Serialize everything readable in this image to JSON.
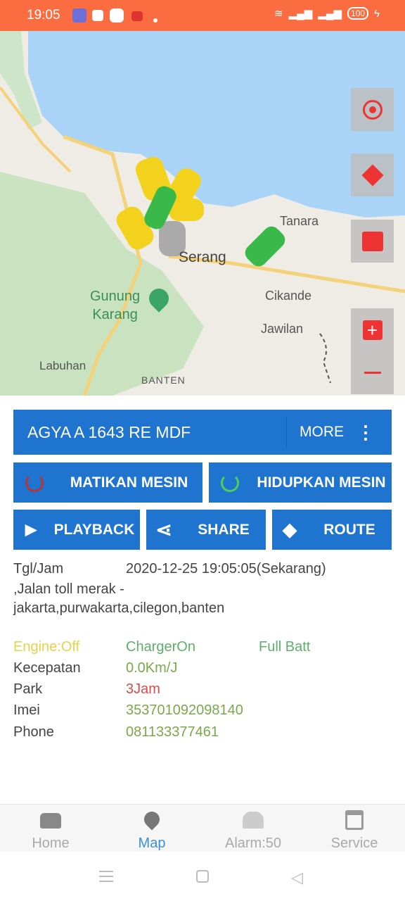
{
  "status_bar": {
    "time": "19:05",
    "battery": "100"
  },
  "map": {
    "labels": {
      "tanara": "Tanara",
      "serang": "Serang",
      "gunung_karang": "Gunung\nKarang",
      "cikande": "Cikande",
      "jawilan": "Jawilan",
      "labuhan": "Labuhan",
      "banten": "BANTEN"
    }
  },
  "vehicle": {
    "title": "AGYA A 1643 RE MDF",
    "more": "MORE"
  },
  "actions": {
    "engine_off": "MATIKAN MESIN",
    "engine_on": "HIDUPKAN MESIN",
    "playback": "PLAYBACK",
    "share": "SHARE",
    "route": "ROUTE"
  },
  "details": {
    "datetime_label": "Tgl/Jam",
    "datetime_value": "2020-12-25 19:05:05(Sekarang)",
    "address_line1": ",Jalan toll merak -",
    "address_line2": "jakarta,purwakarta,cilegon,banten",
    "engine": "Engine:Off",
    "charger": "ChargerOn",
    "battery": "Full Batt",
    "speed_label": "Kecepatan",
    "speed_value": "0.0Km/J",
    "park_label": "Park",
    "park_value": "3Jam",
    "imei_label": "Imei",
    "imei_value": "353701092098140",
    "phone_label": "Phone",
    "phone_value": "081133377461"
  },
  "colors": {
    "engine": "#e8d24a",
    "charger": "#5fae6a",
    "value": "#7aa84a",
    "park": "#d94b4b",
    "accent": "#1f74cf",
    "statusbar": "#fb6d40"
  },
  "bottom_nav": {
    "items": [
      {
        "label": "Home"
      },
      {
        "label": "Map"
      },
      {
        "label": "Alarm:50"
      },
      {
        "label": "Service"
      }
    ]
  }
}
